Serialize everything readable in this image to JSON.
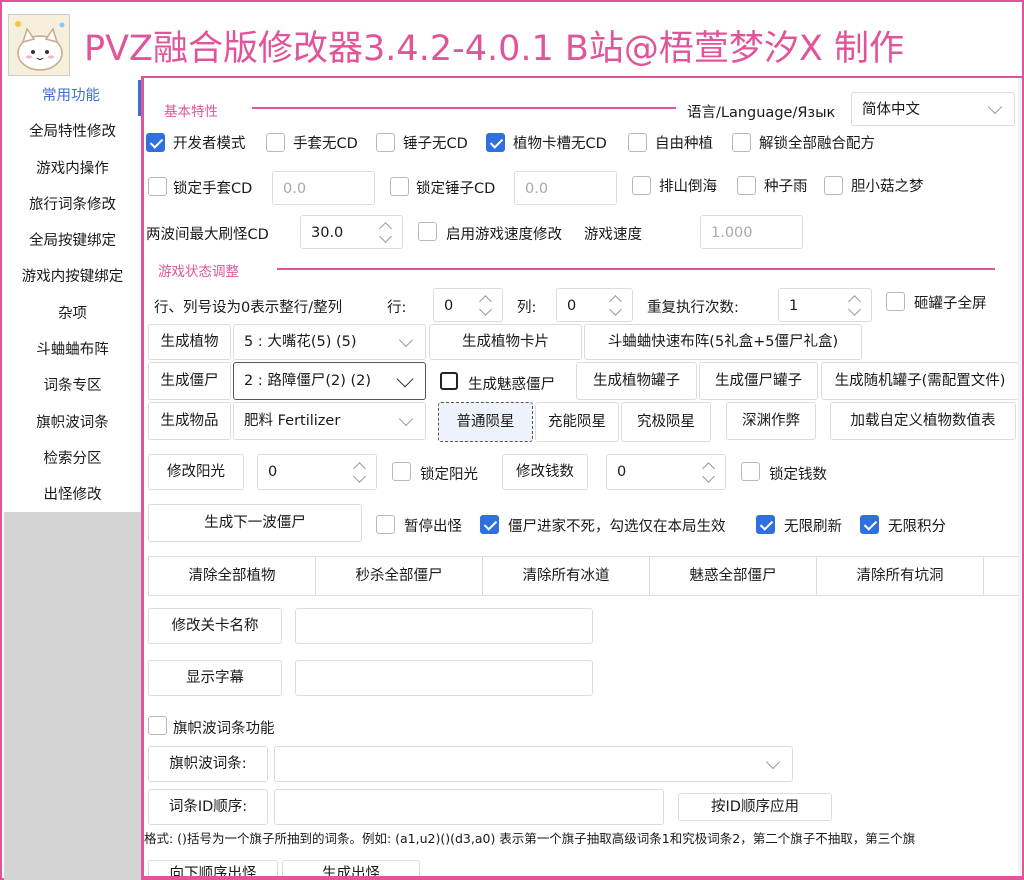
{
  "title": "PVZ融合版修改器3.4.2-4.0.1 B站@梧萱梦汐X 制作",
  "accent_color": "#e0559a",
  "check_color": "#2f6fde",
  "sidebar": {
    "items": [
      "常用功能",
      "全局特性修改",
      "游戏内操作",
      "旅行词条修改",
      "全局按键绑定",
      "游戏内按键绑定",
      "杂项",
      "斗蛐蛐布阵",
      "词条专区",
      "旗帜波词条",
      "检索分区",
      "出怪修改"
    ],
    "active_index": 0
  },
  "basic": {
    "section": "基本特性",
    "language_label": "语言/Language/Язык",
    "language_value": "简体中文",
    "row1": [
      {
        "label": "开发者模式",
        "checked": true
      },
      {
        "label": "手套无CD",
        "checked": false
      },
      {
        "label": "锤子无CD",
        "checked": false
      },
      {
        "label": "植物卡槽无CD",
        "checked": true
      },
      {
        "label": "自由种植",
        "checked": false
      },
      {
        "label": "解锁全部融合配方",
        "checked": false
      }
    ],
    "lock_glove": {
      "label": "锁定手套CD",
      "value": "0.0"
    },
    "lock_hammer": {
      "label": "锁定锤子CD",
      "value": "0.0"
    },
    "row2": [
      {
        "label": "排山倒海",
        "checked": false
      },
      {
        "label": "种子雨",
        "checked": false
      },
      {
        "label": "胆小菇之梦",
        "checked": false
      }
    ],
    "wave_cd_label": "两波间最大刷怪CD",
    "wave_cd_value": "30.0",
    "speed_toggle": "启用游戏速度修改",
    "speed_label": "游戏速度",
    "speed_value": "1.000"
  },
  "state": {
    "section": "游戏状态调整",
    "rowcol_label": "行、列号设为0表示整行/整列",
    "row_label": "行:",
    "row_value": "0",
    "col_label": "列:",
    "col_value": "0",
    "repeat_label": "重复执行次数:",
    "repeat_value": "1",
    "smash_jar": "砸罐子全屏",
    "gen_plant": "生成植物",
    "plant_select": "5 : 大嘴花(5) (5)",
    "gen_plant_card": "生成植物卡片",
    "cricket_fast": "斗蛐蛐快速布阵(5礼盒+5僵尸礼盒)",
    "gen_zombie": "生成僵尸",
    "zombie_select": "2 : 路障僵尸(2) (2)",
    "gen_charm_zombie": "生成魅惑僵尸",
    "gen_plant_jar": "生成植物罐子",
    "gen_zombie_jar": "生成僵尸罐子",
    "gen_random_jar": "生成随机罐子(需配置文件)",
    "gen_item": "生成物品",
    "item_select": "肥料 Fertilizer",
    "meteor_normal": "普通陨星",
    "meteor_power": "充能陨星",
    "meteor_ultimate": "究极陨星",
    "abyss_cheat": "深渊作弊",
    "load_custom": "加载自定义植物数值表",
    "sun_btn": "修改阳光",
    "sun_value": "0",
    "lock_sun": "锁定阳光",
    "money_btn": "修改钱数",
    "money_value": "0",
    "lock_money": "锁定钱数",
    "next_wave": "生成下一波僵尸",
    "pause_spawn": {
      "label": "暂停出怪",
      "checked": false
    },
    "zombie_nodeath": {
      "label": "僵尸进家不死，勾选仅在本局生效",
      "checked": true
    },
    "no_refresh": {
      "label": "无限刷新",
      "checked": true
    },
    "inf_score": {
      "label": "无限积分",
      "checked": true
    },
    "tabs": [
      "清除全部植物",
      "秒杀全部僵尸",
      "清除所有冰道",
      "魅惑全部僵尸",
      "清除所有坑洞"
    ],
    "level_name_btn": "修改关卡名称",
    "show_subtitle_btn": "显示字幕",
    "flag_wave_feature": "旗帜波词条功能",
    "flag_wave_label": "旗帜波词条:",
    "entry_id_label": "词条ID顺序:",
    "apply_by_id": "按ID顺序应用",
    "format_text": "格式: ()括号为一个旗子所抽到的词条。例如: (a1,u2)()(d3,a0) 表示第一个旗子抽取高级词条1和究极词条2，第二个旗子不抽取，第三个旗",
    "bottom_btn1": "向下顺序出怪",
    "bottom_btn2": "生成出怪"
  }
}
